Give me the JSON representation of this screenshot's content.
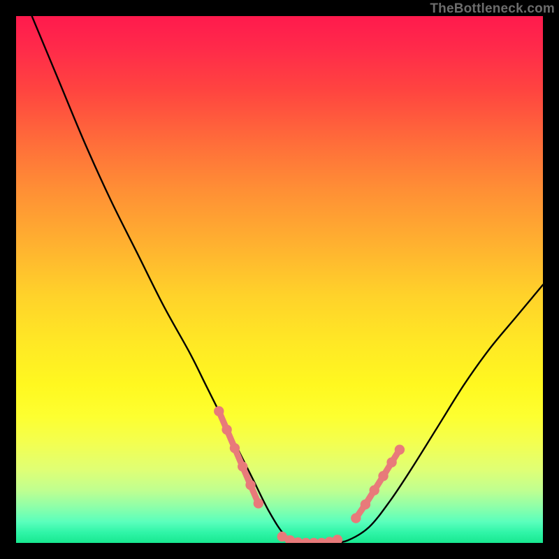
{
  "watermark": "TheBottleneck.com",
  "colors": {
    "curve": "#000000",
    "marker": "#e87a7a",
    "frame": "#000000"
  },
  "chart_data": {
    "type": "line",
    "title": "",
    "xlabel": "",
    "ylabel": "",
    "xlim": [
      0,
      100
    ],
    "ylim": [
      0,
      100
    ],
    "note": "x is a normalized component-performance axis, y is bottleneck % (0 = balanced at valley floor). Curve is a V: steep descent from top-left, flat valley, gentler rise to the right.",
    "series": [
      {
        "name": "bottleneck-curve",
        "x": [
          3,
          8,
          13,
          18,
          23,
          28,
          33,
          36,
          39,
          42,
          45,
          48,
          51,
          54,
          57,
          60,
          63,
          67,
          71,
          75,
          80,
          85,
          90,
          95,
          100
        ],
        "y": [
          100,
          88,
          76,
          65,
          55,
          45,
          36,
          30,
          24,
          18,
          12,
          6,
          1.5,
          0,
          0,
          0,
          0.5,
          3,
          8,
          14,
          22,
          30,
          37,
          43,
          49
        ]
      }
    ],
    "markers": [
      {
        "name": "left-cluster",
        "x": [
          38.5,
          40.0,
          41.5,
          43.0,
          44.5,
          46.0
        ],
        "y": [
          25,
          21.5,
          18,
          14.5,
          11,
          7.5
        ]
      },
      {
        "name": "valley-cluster",
        "x": [
          50.5,
          52.0,
          53.5,
          55.0,
          56.5,
          58.0,
          59.5,
          61.0
        ],
        "y": [
          1.2,
          0.5,
          0.1,
          0,
          0,
          0,
          0.2,
          0.6
        ]
      },
      {
        "name": "right-cluster",
        "x": [
          64.5,
          66.3,
          68.0,
          69.7,
          71.3,
          72.8
        ],
        "y": [
          4.7,
          7.3,
          10.0,
          12.7,
          15.3,
          17.7
        ]
      }
    ]
  }
}
